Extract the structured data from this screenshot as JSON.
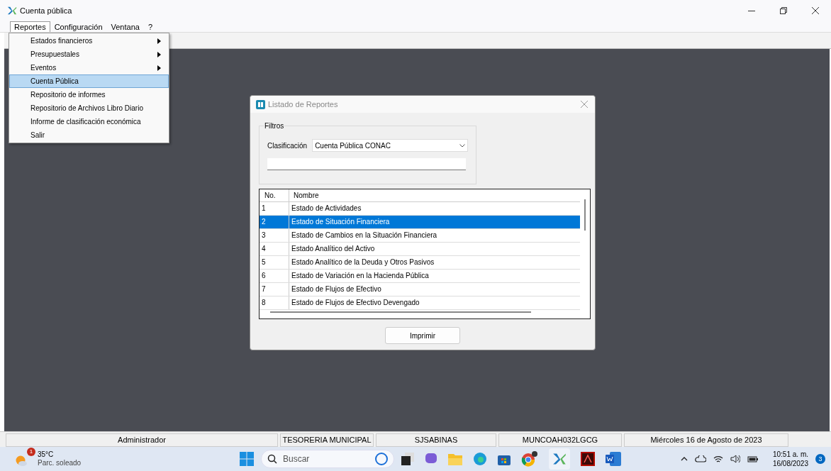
{
  "window": {
    "title": "Cuenta pública"
  },
  "menu_bar": [
    {
      "label": "Reportes",
      "selected": true
    },
    {
      "label": "Configuración",
      "selected": false
    },
    {
      "label": "Ventana",
      "selected": false
    },
    {
      "label": "?",
      "selected": false
    }
  ],
  "dropdown": [
    {
      "label": "Estados financieros",
      "submenu": true,
      "selected": false
    },
    {
      "label": "Presupuestales",
      "submenu": true,
      "selected": false
    },
    {
      "label": "Eventos",
      "submenu": true,
      "selected": false
    },
    {
      "label": "Cuenta Pública",
      "submenu": false,
      "selected": true
    },
    {
      "label": "Repositorio de informes",
      "submenu": false,
      "selected": false
    },
    {
      "label": "Repositorio de Archivos Libro Diario",
      "submenu": false,
      "selected": false
    },
    {
      "label": "Informe de clasificación económica",
      "submenu": false,
      "selected": false
    },
    {
      "label": "Salir",
      "submenu": false,
      "selected": false
    }
  ],
  "dialog": {
    "title": "Listado de Reportes",
    "filters": {
      "label": "Filtros",
      "classification_label": "Clasificación",
      "classification_value": "Cuenta Pública CONAC"
    },
    "table": {
      "columns": [
        "No.",
        "Nombre"
      ],
      "rows": [
        {
          "no": "1",
          "name": "Estado de Actividades",
          "selected": false
        },
        {
          "no": "2",
          "name": "Estado de Situación Financiera",
          "selected": true
        },
        {
          "no": "3",
          "name": "Estado de Cambios en la Situación Financiera",
          "selected": false
        },
        {
          "no": "4",
          "name": "Estado Analítico del Activo",
          "selected": false
        },
        {
          "no": "5",
          "name": "Estado Analítico de la Deuda y Otros Pasivos",
          "selected": false
        },
        {
          "no": "6",
          "name": "Estado de Variación en la Hacienda Pública",
          "selected": false
        },
        {
          "no": "7",
          "name": "Estado de Flujos de Efectivo",
          "selected": false
        },
        {
          "no": "8",
          "name": "Estado de Flujos de Efectivo Devengado",
          "selected": false
        }
      ]
    },
    "button": "Imprimir"
  },
  "status_bar": [
    "Administrador",
    "TESORERIA MUNICIPAL",
    "SJSABINAS",
    "MUNCOAH032LGCG",
    "Miércoles 16 de Agosto de 2023"
  ],
  "taskbar": {
    "weather": {
      "badge": "1",
      "temperature": "35°C",
      "condition": "Parc. soleado"
    },
    "search": {
      "placeholder": "Buscar"
    },
    "clock": {
      "time": "10:51 a. m.",
      "date": "16/08/2023"
    },
    "notifications": "3"
  }
}
